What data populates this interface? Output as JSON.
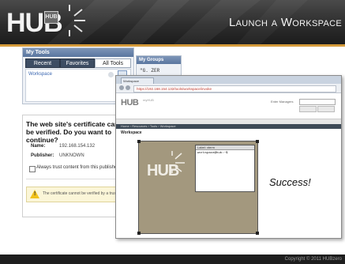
{
  "slide": {
    "logo": "HUB",
    "logo_badge": "HUB",
    "title": "Launch a Workspace",
    "copyright": "Copyright © 2011 HUBzero"
  },
  "my_tools": {
    "title": "My Tools",
    "tabs": [
      "Recent",
      "Favorites",
      "All Tools"
    ],
    "active_tab": "All Tools",
    "items": [
      "Workspace"
    ]
  },
  "my_groups": {
    "title": "My Groups",
    "item": "\"G. ZER"
  },
  "certificate_dialog": {
    "question": "The web site's certificate cannot be verified. Do you want to continue?",
    "name_label": "Name:",
    "name_value": "192.168.154.132",
    "publisher_label": "Publisher:",
    "publisher_value": "UNKNOWN",
    "checkbox_label": "Always trust content from this publisher.",
    "warning_text": "The certificate cannot be verified by a trusted source."
  },
  "browser": {
    "tab_label": "Workspace",
    "url": "https://192.168.154.132/tools/workspace/invoke",
    "site_name": "HUB",
    "site_sub": "myHUB",
    "login_text": "Enter Managers",
    "breadcrumb": "Home › Resources › Tools › Workspace",
    "page_title": "Workspace"
  },
  "workspace": {
    "logo": "HUB",
    "xterm_title": "Label: xterm",
    "xterm_prompt": "workspace@hub:~$ "
  },
  "success_text": "Success!",
  "colors": {
    "accent": "#d49a3a",
    "workspace_bg": "#a3987e",
    "panel_title": "#5a769f"
  }
}
